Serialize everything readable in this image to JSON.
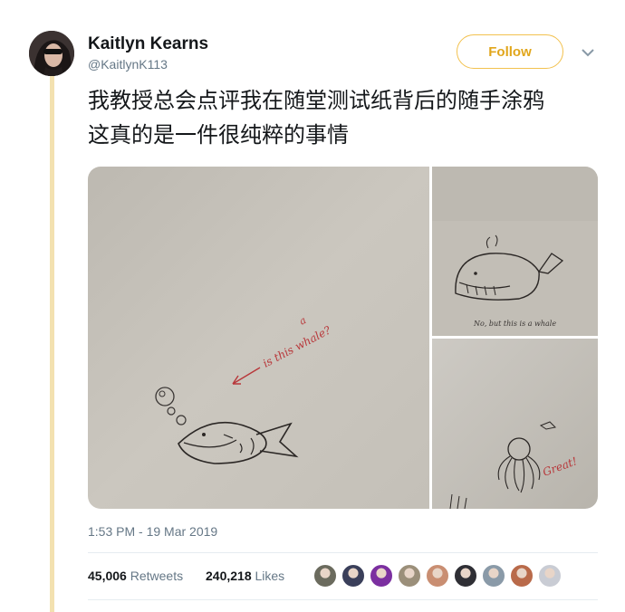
{
  "tweet": {
    "display_name": "Kaitlyn Kearns",
    "handle": "@KaitlynK113",
    "follow_label": "Follow",
    "text_line1": "我教授总会点评我在随堂测试纸背后的随手涂鸦",
    "text_line2": "这真的是一件很纯粹的事情",
    "timestamp": "1:53 PM - 19 Mar 2019",
    "retweets_count": "45,006",
    "retweets_label": "Retweets",
    "likes_count": "240,218",
    "likes_label": "Likes"
  },
  "media": {
    "photo1_note": "is this whale?",
    "photo1_note_insert": "a",
    "photo2_note": "No, but this is a whale",
    "photo3_note": "Great!"
  },
  "likers": [
    {
      "icon": "avatar-1",
      "color": "#6b6b5e"
    },
    {
      "icon": "avatar-2",
      "color": "#3a3f5a"
    },
    {
      "icon": "avatar-3",
      "color": "#7b2fa0"
    },
    {
      "icon": "avatar-4",
      "color": "#9b8f7a"
    },
    {
      "icon": "avatar-5",
      "color": "#c98e72"
    },
    {
      "icon": "avatar-6",
      "color": "#2f2f35"
    },
    {
      "icon": "avatar-7",
      "color": "#8a9aa8"
    },
    {
      "icon": "avatar-8",
      "color": "#b96a4a"
    },
    {
      "icon": "avatar-9",
      "color": "#c9ccd4"
    }
  ],
  "colors": {
    "accent": "#f2c14e",
    "thread_line": "#f3e1b0",
    "secondary_text": "#657786",
    "paper": "#cbc7bf",
    "red_ink": "#b8373a"
  }
}
